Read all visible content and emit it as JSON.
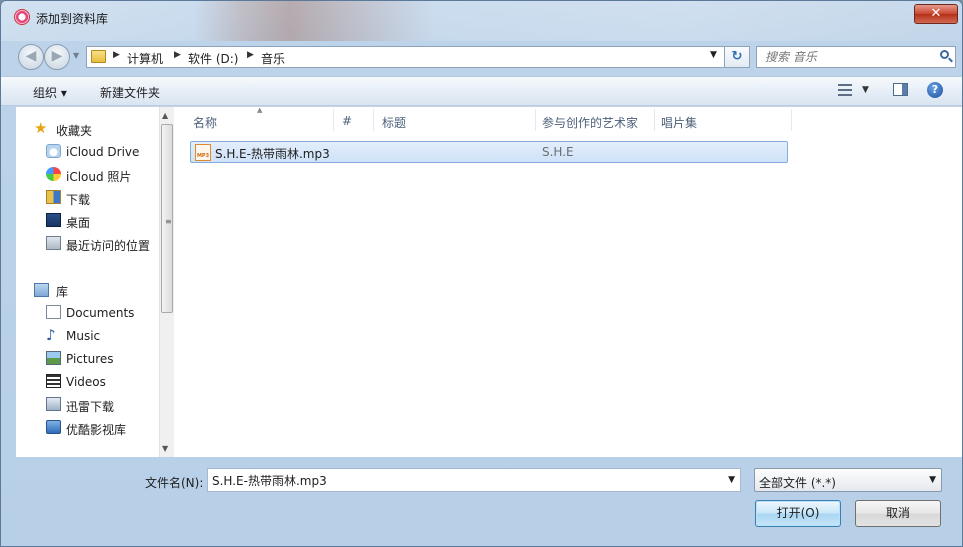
{
  "window": {
    "title": "添加到资料库",
    "close_label": "✕"
  },
  "nav": {
    "back": "◀",
    "forward": "▶",
    "history": "▼",
    "breadcrumbs": [
      "计算机",
      "软件 (D:)",
      "音乐"
    ],
    "search_placeholder": "搜索 音乐"
  },
  "toolbar": {
    "organize": "组织 ▾",
    "new_folder": "新建文件夹"
  },
  "sidebar": {
    "favorites": [
      {
        "label": "收藏夹",
        "icon": "star-icon"
      },
      {
        "label": "iCloud Drive",
        "icon": "icloud-icon"
      },
      {
        "label": "iCloud 照片",
        "icon": "photos-icon"
      },
      {
        "label": "下载",
        "icon": "download-folder-icon"
      },
      {
        "label": "桌面",
        "icon": "desktop-icon"
      },
      {
        "label": "最近访问的位置",
        "icon": "recent-places-icon"
      }
    ],
    "libraries": [
      {
        "label": "库",
        "icon": "library-icon"
      },
      {
        "label": "Documents",
        "icon": "documents-icon"
      },
      {
        "label": "Music",
        "icon": "music-icon"
      },
      {
        "label": "Pictures",
        "icon": "pictures-icon"
      },
      {
        "label": "Videos",
        "icon": "videos-icon"
      },
      {
        "label": "迅雷下载",
        "icon": "thunder-download-icon"
      },
      {
        "label": "优酷影视库",
        "icon": "youku-library-icon"
      }
    ]
  },
  "columns": [
    "名称",
    "#",
    "标题",
    "参与创作的艺术家",
    "唱片集"
  ],
  "files": [
    {
      "name": "S.H.E-热带雨林.mp3",
      "number": "",
      "title": "",
      "artist": "S.H.E",
      "album": "",
      "type_badge": "MP3"
    }
  ],
  "bottom": {
    "filename_label": "文件名(N):",
    "filename_value": "S.H.E-热带雨林.mp3",
    "filetype_value": "全部文件 (*.*)",
    "open_label": "打开(O)",
    "cancel_label": "取消"
  }
}
